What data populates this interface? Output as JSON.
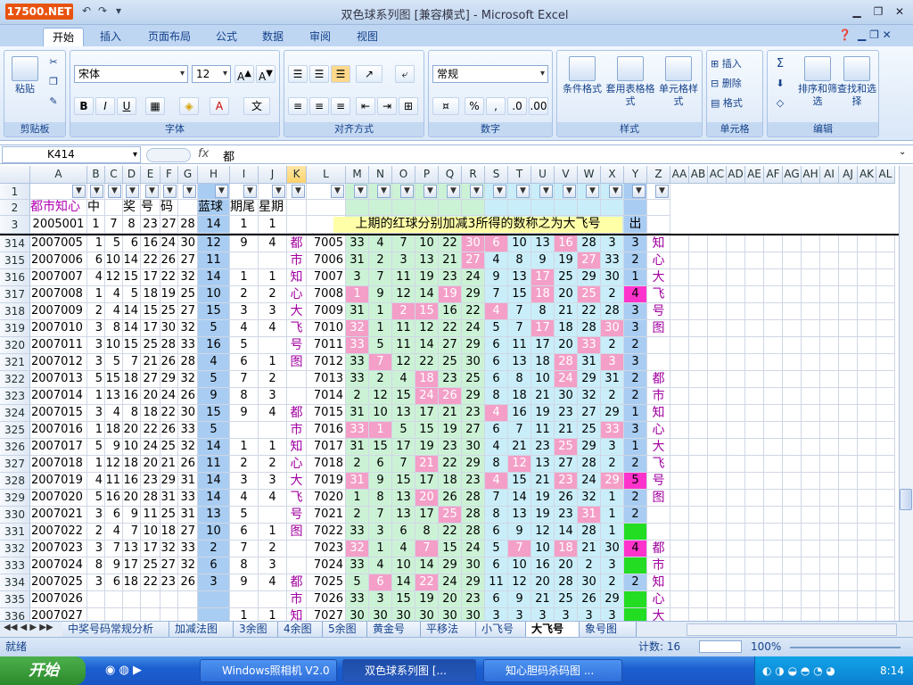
{
  "window": {
    "title": "双色球系列图  [兼容模式] - Microsoft Excel",
    "logo": "17500.NET"
  },
  "ribbon_tabs": [
    "开始",
    "插入",
    "页面布局",
    "公式",
    "数据",
    "审阅",
    "视图"
  ],
  "clipboard": {
    "paste": "粘贴",
    "label": "剪贴板"
  },
  "font": {
    "name": "宋体",
    "size": "12",
    "label": "字体"
  },
  "alignment": {
    "label": "对齐方式"
  },
  "number": {
    "format": "常规",
    "label": "数字"
  },
  "styles": {
    "conditional": "条件格式",
    "table": "套用表格格式",
    "cell": "单元格样式",
    "label": "样式"
  },
  "cells": {
    "insert": "插入",
    "delete": "删除",
    "format": "格式",
    "label": "单元格"
  },
  "editing": {
    "sort": "排序和筛选",
    "find": "查找和选择",
    "label": "编辑"
  },
  "formula_bar": {
    "name_box": "K414",
    "fx": "fx",
    "value": "都"
  },
  "columns": [
    "A",
    "B",
    "C",
    "D",
    "E",
    "F",
    "G",
    "H",
    "I",
    "J",
    "K",
    "L",
    "M",
    "N",
    "O",
    "P",
    "Q",
    "R",
    "S",
    "T",
    "U",
    "V",
    "W",
    "X",
    "Y",
    "Z",
    "AA",
    "AB",
    "AC",
    "AD",
    "AE",
    "AF",
    "AG",
    "AH",
    "AI",
    "AJ",
    "AK",
    "AL"
  ],
  "header_rows": [
    {
      "num": "1",
      "cells": []
    },
    {
      "num": "2",
      "cells": [
        "都市知心",
        "中",
        "",
        "奖",
        "号",
        "码",
        "",
        "蓝球",
        "期尾",
        "星期"
      ]
    },
    {
      "num": "3",
      "cells": [
        "2005001",
        "1",
        "7",
        "8",
        "23",
        "27",
        "28",
        "14",
        "1",
        "1"
      ],
      "banner": "上期的红球分别加减3所得的数称之为大飞号",
      "banner_end": "出"
    }
  ],
  "rows": [
    {
      "num": "314",
      "id": "2007005",
      "red": [
        "1",
        "5",
        "6",
        "16",
        "24",
        "30"
      ],
      "blue": "12",
      "tail": "9",
      "week": "4",
      "k": "都",
      "l": "7005",
      "m": [
        "33",
        "4",
        "7",
        "10",
        "22",
        "30",
        "6",
        "10",
        "13",
        "16",
        "28",
        "3"
      ],
      "y": "3",
      "z": "知"
    },
    {
      "num": "315",
      "id": "2007006",
      "red": [
        "6",
        "10",
        "14",
        "22",
        "26",
        "27"
      ],
      "blue": "11",
      "tail": "",
      "week": "",
      "k": "市",
      "l": "7006",
      "m": [
        "31",
        "2",
        "3",
        "13",
        "21",
        "27",
        "4",
        "8",
        "9",
        "19",
        "27",
        "33"
      ],
      "y": "2",
      "z": "心"
    },
    {
      "num": "316",
      "id": "2007007",
      "red": [
        "4",
        "12",
        "15",
        "17",
        "22",
        "32"
      ],
      "blue": "14",
      "tail": "1",
      "week": "1",
      "k": "知",
      "l": "7007",
      "m": [
        "3",
        "7",
        "11",
        "19",
        "23",
        "24",
        "9",
        "13",
        "17",
        "25",
        "29",
        "30"
      ],
      "y": "1",
      "z": "大"
    },
    {
      "num": "317",
      "id": "2007008",
      "red": [
        "1",
        "4",
        "5",
        "18",
        "19",
        "25"
      ],
      "blue": "10",
      "tail": "2",
      "week": "2",
      "k": "心",
      "l": "7008",
      "m": [
        "1",
        "9",
        "12",
        "14",
        "19",
        "29",
        "7",
        "15",
        "18",
        "20",
        "25",
        "2"
      ],
      "y": "4",
      "z": "飞"
    },
    {
      "num": "318",
      "id": "2007009",
      "red": [
        "2",
        "4",
        "14",
        "15",
        "25",
        "27"
      ],
      "blue": "15",
      "tail": "3",
      "week": "3",
      "k": "大",
      "l": "7009",
      "m": [
        "31",
        "1",
        "2",
        "15",
        "16",
        "22",
        "4",
        "7",
        "8",
        "21",
        "22",
        "28"
      ],
      "y": "3",
      "z": "号"
    },
    {
      "num": "319",
      "id": "2007010",
      "red": [
        "3",
        "8",
        "14",
        "17",
        "30",
        "32"
      ],
      "blue": "5",
      "tail": "4",
      "week": "4",
      "k": "飞",
      "l": "7010",
      "m": [
        "32",
        "1",
        "11",
        "12",
        "22",
        "24",
        "5",
        "7",
        "17",
        "18",
        "28",
        "30"
      ],
      "y": "3",
      "z": "图"
    },
    {
      "num": "320",
      "id": "2007011",
      "red": [
        "3",
        "10",
        "15",
        "25",
        "28",
        "33"
      ],
      "blue": "16",
      "tail": "5",
      "week": "",
      "k": "号",
      "l": "7011",
      "m": [
        "33",
        "5",
        "11",
        "14",
        "27",
        "29",
        "6",
        "11",
        "17",
        "20",
        "33",
        "2"
      ],
      "y": "2",
      "z": ""
    },
    {
      "num": "321",
      "id": "2007012",
      "red": [
        "3",
        "5",
        "7",
        "21",
        "26",
        "28"
      ],
      "blue": "4",
      "tail": "6",
      "week": "1",
      "k": "图",
      "l": "7012",
      "m": [
        "33",
        "7",
        "12",
        "22",
        "25",
        "30",
        "6",
        "13",
        "18",
        "28",
        "31",
        "3"
      ],
      "y": "3",
      "z": ""
    },
    {
      "num": "322",
      "id": "2007013",
      "red": [
        "5",
        "15",
        "18",
        "27",
        "29",
        "32"
      ],
      "blue": "5",
      "tail": "7",
      "week": "2",
      "k": "",
      "l": "7013",
      "m": [
        "33",
        "2",
        "4",
        "18",
        "23",
        "25",
        "6",
        "8",
        "10",
        "24",
        "29",
        "31"
      ],
      "y": "2",
      "z": "都"
    },
    {
      "num": "323",
      "id": "2007014",
      "red": [
        "1",
        "13",
        "16",
        "20",
        "24",
        "26"
      ],
      "blue": "9",
      "tail": "8",
      "week": "3",
      "k": "",
      "l": "7014",
      "m": [
        "2",
        "12",
        "15",
        "24",
        "26",
        "29",
        "8",
        "18",
        "21",
        "30",
        "32",
        "2"
      ],
      "y": "2",
      "z": "市"
    },
    {
      "num": "324",
      "id": "2007015",
      "red": [
        "3",
        "4",
        "8",
        "18",
        "22",
        "30"
      ],
      "blue": "15",
      "tail": "9",
      "week": "4",
      "k": "都",
      "l": "7015",
      "m": [
        "31",
        "10",
        "13",
        "17",
        "21",
        "23",
        "4",
        "16",
        "19",
        "23",
        "27",
        "29"
      ],
      "y": "1",
      "z": "知"
    },
    {
      "num": "325",
      "id": "2007016",
      "red": [
        "1",
        "18",
        "20",
        "22",
        "26",
        "33"
      ],
      "blue": "5",
      "tail": "",
      "week": "",
      "k": "市",
      "l": "7016",
      "m": [
        "33",
        "1",
        "5",
        "15",
        "19",
        "27",
        "6",
        "7",
        "11",
        "21",
        "25",
        "33"
      ],
      "y": "3",
      "z": "心"
    },
    {
      "num": "326",
      "id": "2007017",
      "red": [
        "5",
        "9",
        "10",
        "24",
        "25",
        "32"
      ],
      "blue": "14",
      "tail": "1",
      "week": "1",
      "k": "知",
      "l": "7017",
      "m": [
        "31",
        "15",
        "17",
        "19",
        "23",
        "30",
        "4",
        "21",
        "23",
        "25",
        "29",
        "3"
      ],
      "y": "1",
      "z": "大"
    },
    {
      "num": "327",
      "id": "2007018",
      "red": [
        "1",
        "12",
        "18",
        "20",
        "21",
        "26"
      ],
      "blue": "11",
      "tail": "2",
      "week": "2",
      "k": "心",
      "l": "7018",
      "m": [
        "2",
        "6",
        "7",
        "21",
        "22",
        "29",
        "8",
        "12",
        "13",
        "27",
        "28",
        "2"
      ],
      "y": "2",
      "z": "飞"
    },
    {
      "num": "328",
      "id": "2007019",
      "red": [
        "4",
        "11",
        "16",
        "23",
        "29",
        "31"
      ],
      "blue": "14",
      "tail": "3",
      "week": "3",
      "k": "大",
      "l": "7019",
      "m": [
        "31",
        "9",
        "15",
        "17",
        "18",
        "23",
        "4",
        "15",
        "21",
        "23",
        "24",
        "29"
      ],
      "y": "5",
      "z": "号"
    },
    {
      "num": "329",
      "id": "2007020",
      "red": [
        "5",
        "16",
        "20",
        "28",
        "31",
        "33"
      ],
      "blue": "14",
      "tail": "4",
      "week": "4",
      "k": "飞",
      "l": "7020",
      "m": [
        "1",
        "8",
        "13",
        "20",
        "26",
        "28",
        "7",
        "14",
        "19",
        "26",
        "32",
        "1"
      ],
      "y": "2",
      "z": "图"
    },
    {
      "num": "330",
      "id": "2007021",
      "red": [
        "3",
        "6",
        "9",
        "11",
        "25",
        "31"
      ],
      "blue": "13",
      "tail": "5",
      "week": "",
      "k": "号",
      "l": "7021",
      "m": [
        "2",
        "7",
        "13",
        "17",
        "25",
        "28",
        "8",
        "13",
        "19",
        "23",
        "31",
        "1"
      ],
      "y": "2",
      "z": ""
    },
    {
      "num": "331",
      "id": "2007022",
      "red": [
        "2",
        "4",
        "7",
        "10",
        "18",
        "27"
      ],
      "blue": "10",
      "tail": "6",
      "week": "1",
      "k": "图",
      "l": "7022",
      "m": [
        "33",
        "3",
        "6",
        "8",
        "22",
        "28",
        "6",
        "9",
        "12",
        "14",
        "28",
        "1"
      ],
      "y": "",
      "z": ""
    },
    {
      "num": "332",
      "id": "2007023",
      "red": [
        "3",
        "7",
        "13",
        "17",
        "32",
        "33"
      ],
      "blue": "2",
      "tail": "7",
      "week": "2",
      "k": "",
      "l": "7023",
      "m": [
        "32",
        "1",
        "4",
        "7",
        "15",
        "24",
        "5",
        "7",
        "10",
        "18",
        "21",
        "30"
      ],
      "y": "4",
      "z": "都"
    },
    {
      "num": "333",
      "id": "2007024",
      "red": [
        "8",
        "9",
        "17",
        "25",
        "27",
        "32"
      ],
      "blue": "6",
      "tail": "8",
      "week": "3",
      "k": "",
      "l": "7024",
      "m": [
        "33",
        "4",
        "10",
        "14",
        "29",
        "30",
        "6",
        "10",
        "16",
        "20",
        "2",
        "3"
      ],
      "y": "",
      "z": "市"
    },
    {
      "num": "334",
      "id": "2007025",
      "red": [
        "3",
        "6",
        "18",
        "22",
        "23",
        "26"
      ],
      "blue": "3",
      "tail": "9",
      "week": "4",
      "k": "都",
      "l": "7025",
      "m": [
        "5",
        "6",
        "14",
        "22",
        "24",
        "29",
        "11",
        "12",
        "20",
        "28",
        "30",
        "2"
      ],
      "y": "2",
      "z": "知"
    },
    {
      "num": "335",
      "id": "2007026",
      "red": [
        "",
        "",
        "",
        "",
        "",
        ""
      ],
      "blue": "",
      "tail": "",
      "week": "",
      "k": "市",
      "l": "7026",
      "m": [
        "33",
        "3",
        "15",
        "19",
        "20",
        "23",
        "6",
        "9",
        "21",
        "25",
        "26",
        "29"
      ],
      "y": "",
      "z": "心"
    },
    {
      "num": "336",
      "id": "2007027",
      "red": [
        "",
        "",
        "",
        "",
        "",
        ""
      ],
      "blue": "",
      "tail": "1",
      "week": "1",
      "k": "知",
      "l": "7027",
      "m": [
        "30",
        "30",
        "30",
        "30",
        "30",
        "30",
        "3",
        "3",
        "3",
        "3",
        "3",
        "3"
      ],
      "y": "",
      "z": "大"
    }
  ],
  "sheet_tabs": [
    "中奖号码常规分析",
    "加减法图",
    "3余图",
    "4余图",
    "5余图",
    "黄金号",
    "平移法",
    "小飞号",
    "大飞号",
    "象号图"
  ],
  "active_sheet": "大飞号",
  "status": {
    "ready": "就绪",
    "count": "计数: 16",
    "zoom": "100%"
  },
  "taskbar": {
    "start": "开始",
    "items": [
      "Windows照相机 V2.0",
      "双色球系列图  [...",
      "知心胆码杀码图  ..."
    ],
    "time": "8:14"
  }
}
